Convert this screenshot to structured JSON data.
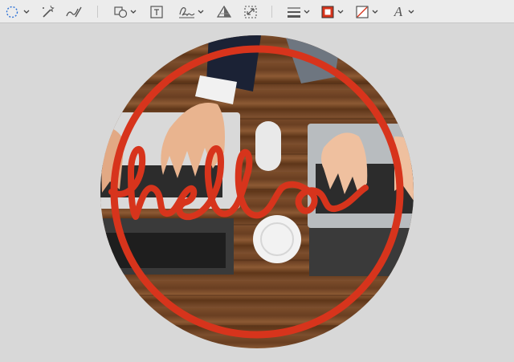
{
  "toolbar": {
    "tools": [
      {
        "icon": "selection-tool-icon",
        "has_dropdown": true
      },
      {
        "icon": "instant-alpha-icon",
        "has_dropdown": false
      },
      {
        "icon": "sketch-icon",
        "has_dropdown": false
      },
      {
        "icon": "shapes-icon",
        "has_dropdown": true
      },
      {
        "icon": "text-icon",
        "has_dropdown": false
      },
      {
        "icon": "sign-icon",
        "has_dropdown": true
      },
      {
        "icon": "adjust-color-icon",
        "has_dropdown": false
      },
      {
        "icon": "adjust-size-icon",
        "has_dropdown": false
      },
      {
        "icon": "shape-style-icon",
        "has_dropdown": true
      },
      {
        "icon": "border-color-icon",
        "has_dropdown": true
      },
      {
        "icon": "fill-color-icon",
        "has_dropdown": true
      },
      {
        "icon": "text-style-icon",
        "has_dropdown": true
      }
    ],
    "text_style_glyph": "A"
  },
  "canvas": {
    "annotation_text": "hello",
    "colors": {
      "annotation": "#d7341c",
      "background": "#d8d8d8",
      "toolbar": "#ececec"
    }
  }
}
